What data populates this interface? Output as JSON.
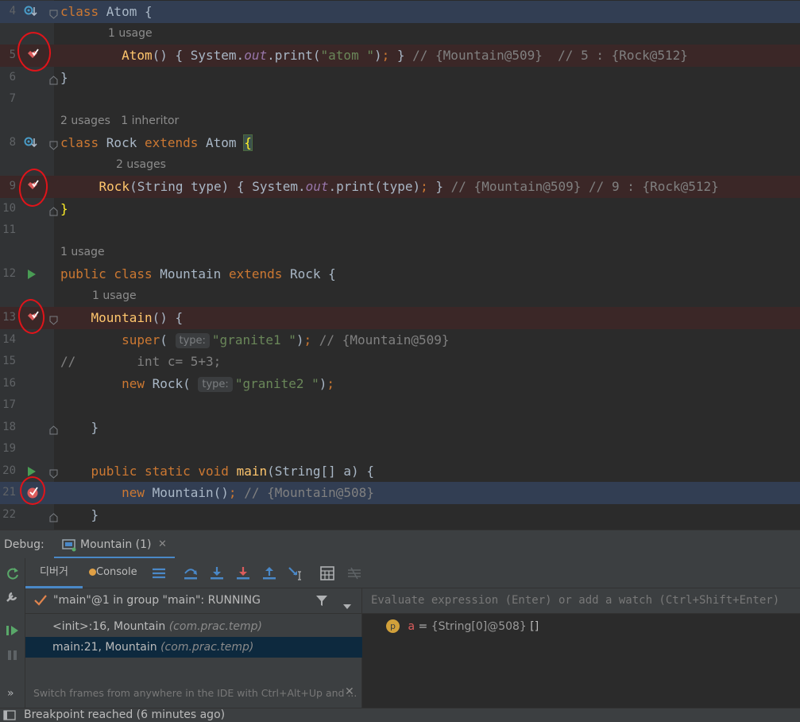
{
  "editor": {
    "lines": [
      {
        "num": "4",
        "hint": "",
        "code": [
          {
            "t": "kw",
            "v": "class "
          },
          {
            "t": "",
            "v": "Atom {"
          }
        ]
      },
      {
        "num": "",
        "hint": "1 usage",
        "code": []
      },
      {
        "num": "5",
        "hint": "",
        "code": [
          {
            "t": "",
            "v": "        "
          },
          {
            "t": "fn",
            "v": "Atom"
          },
          {
            "t": "",
            "v": "() { System."
          },
          {
            "t": "fld",
            "v": "out"
          },
          {
            "t": "",
            "v": ".print("
          },
          {
            "t": "str",
            "v": "\"atom \""
          },
          {
            "t": "",
            "v": ")"
          },
          {
            "t": "kw",
            "v": "; "
          },
          {
            "t": "",
            "v": "} "
          },
          {
            "t": "cmt",
            "v": "// {Mountain@509}  // 5 : {Rock@512}"
          }
        ]
      },
      {
        "num": "6",
        "hint": "",
        "code": [
          {
            "t": "",
            "v": "}"
          }
        ]
      },
      {
        "num": "7",
        "hint": "",
        "code": []
      },
      {
        "num": "",
        "hint": "2 usages   1 inheritor",
        "code": []
      },
      {
        "num": "8",
        "hint": "",
        "code": [
          {
            "t": "kw",
            "v": "class "
          },
          {
            "t": "",
            "v": "Rock "
          },
          {
            "t": "kw",
            "v": "extends "
          },
          {
            "t": "",
            "v": "Atom "
          },
          {
            "t": "bm",
            "v": "{"
          }
        ]
      },
      {
        "num": "",
        "hint": "2 usages",
        "code": []
      },
      {
        "num": "9",
        "hint": "",
        "code": [
          {
            "t": "",
            "v": "    "
          },
          {
            "t": "fn",
            "v": "Rock"
          },
          {
            "t": "",
            "v": "(String type) { System."
          },
          {
            "t": "fld",
            "v": "out"
          },
          {
            "t": "",
            "v": ".print(type)"
          },
          {
            "t": "kw",
            "v": "; "
          },
          {
            "t": "",
            "v": "} "
          },
          {
            "t": "cmt",
            "v": "// {Mountain@509} // 9 : {Rock@512}"
          }
        ]
      },
      {
        "num": "10",
        "hint": "",
        "code": [
          {
            "t": "by",
            "v": "}"
          }
        ]
      },
      {
        "num": "11",
        "hint": "",
        "code": []
      },
      {
        "num": "",
        "hint": "1 usage",
        "code": []
      },
      {
        "num": "12",
        "hint": "",
        "code": [
          {
            "t": "kw",
            "v": "public class "
          },
          {
            "t": "",
            "v": "Mountain "
          },
          {
            "t": "kw",
            "v": "extends "
          },
          {
            "t": "",
            "v": "Rock {"
          }
        ]
      },
      {
        "num": "",
        "hint": "1 usage",
        "code": []
      },
      {
        "num": "13",
        "hint": "",
        "code": [
          {
            "t": "",
            "v": "    "
          },
          {
            "t": "fn",
            "v": "Mountain"
          },
          {
            "t": "",
            "v": "() {"
          }
        ]
      },
      {
        "num": "14",
        "hint": "",
        "code": [
          {
            "t": "",
            "v": "        "
          },
          {
            "t": "kw",
            "v": "super"
          },
          {
            "t": "",
            "v": "( "
          },
          {
            "t": "param",
            "v": "type:"
          },
          {
            "t": "str",
            "v": "\"granite1 \""
          },
          {
            "t": "",
            "v": ")"
          },
          {
            "t": "kw",
            "v": "; "
          },
          {
            "t": "cmt",
            "v": "// {Mountain@509}"
          }
        ]
      },
      {
        "num": "15",
        "hint": "",
        "code": [
          {
            "t": "cmt",
            "v": "//        int c= 5+3;"
          }
        ]
      },
      {
        "num": "16",
        "hint": "",
        "code": [
          {
            "t": "",
            "v": "        "
          },
          {
            "t": "kw",
            "v": "new "
          },
          {
            "t": "",
            "v": "Rock( "
          },
          {
            "t": "param",
            "v": "type:"
          },
          {
            "t": "str",
            "v": "\"granite2 \""
          },
          {
            "t": "",
            "v": ")"
          },
          {
            "t": "kw",
            "v": ";"
          }
        ]
      },
      {
        "num": "17",
        "hint": "",
        "code": []
      },
      {
        "num": "18",
        "hint": "",
        "code": [
          {
            "t": "",
            "v": "    }"
          }
        ]
      },
      {
        "num": "19",
        "hint": "",
        "code": []
      },
      {
        "num": "20",
        "hint": "",
        "code": [
          {
            "t": "",
            "v": "    "
          },
          {
            "t": "kw",
            "v": "public static void "
          },
          {
            "t": "fn",
            "v": "main"
          },
          {
            "t": "",
            "v": "(String[] a) {"
          }
        ]
      },
      {
        "num": "21",
        "hint": "",
        "code": [
          {
            "t": "",
            "v": "        "
          },
          {
            "t": "kw",
            "v": "new "
          },
          {
            "t": "",
            "v": "Mountain()"
          },
          {
            "t": "kw",
            "v": "; "
          },
          {
            "t": "cmt",
            "v": "// {Mountain@508}"
          }
        ]
      },
      {
        "num": "22",
        "hint": "",
        "code": [
          {
            "t": "",
            "v": "    }"
          }
        ]
      }
    ]
  },
  "debug": {
    "title": "Debug:",
    "session_tab": "Mountain (1)",
    "tabs": {
      "debugger": "디버거",
      "console": "Console"
    },
    "thread": "\"main\"@1 in group \"main\": RUNNING",
    "frames": [
      {
        "method": "<init>:16, Mountain",
        "pkg": "(com.prac.temp)"
      },
      {
        "method": "main:21, Mountain",
        "pkg": "(com.prac.temp)"
      }
    ],
    "tip": "Switch frames from anywhere in the IDE with Ctrl+Alt+Up and ...",
    "eval_placeholder": "Evaluate expression (Enter) or add a watch (Ctrl+Shift+Enter)",
    "variable": {
      "badge": "p",
      "name": "a",
      "eq": " = ",
      "value": "{String[0]@508}",
      "extra": " []"
    }
  },
  "status": {
    "text": "Breakpoint reached (6 minutes ago)"
  },
  "colors": {
    "keyword": "#cc7832",
    "function": "#ffc66d",
    "string": "#6a8759",
    "comment": "#808080",
    "breakpoint": "#db5c5c",
    "annotation_circle": "#e0141a",
    "current_line": "#323e53",
    "breakpoint_line": "#3b2727"
  }
}
